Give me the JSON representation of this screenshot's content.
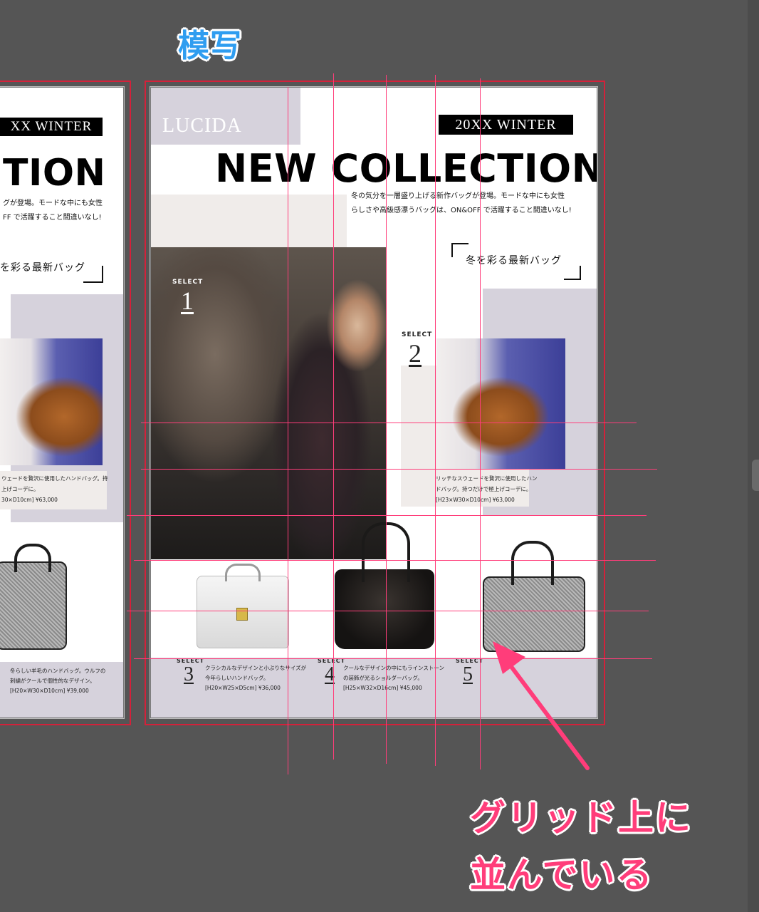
{
  "top_label": "模写",
  "annotation": {
    "line1": "グリッド上に",
    "line2": "並んでいる"
  },
  "poster": {
    "brand": "LUCIDA",
    "season": "20XX WINTER",
    "headline": "NEW COLLECTION",
    "desc_line1": "冬の気分を一層盛り上げる新作バッグが登場。モードな中にも女性",
    "desc_line2": "らしさや高級感漂うバッグは、ON&OFF で活躍すること間違いなし!",
    "bracket_text": "冬を彩る最新バッグ",
    "select_label": "SELECT",
    "items": [
      {
        "num": "1"
      },
      {
        "num": "2",
        "line1": "リッチなスウェードを贅沢に使用したハン",
        "line2": "ドバッグ。持つだけで極上げコーデに。",
        "line3": "[H23×W30×D10cm] ¥63,000"
      },
      {
        "num": "3",
        "line1": "クラシカルなデザインと小ぶりなサイズが",
        "line2": "今年らしいハンドバッグ。",
        "line3": "[H20×W25×D5cm] ¥36,000"
      },
      {
        "num": "4",
        "line1": "クールなデザインの中にもラインストーン",
        "line2": "の装飾が光るショルダーバッグ。",
        "line3": "[H25×W32×D16cm] ¥45,000"
      },
      {
        "num": "5"
      }
    ]
  },
  "original": {
    "season_cut": "XX WINTER",
    "headline_cut": "TION",
    "desc_line1": "グが登場。モードな中にも女性",
    "desc_line2": "FF で活躍すること間違いなし!",
    "bracket_text": "を彩る最新バッグ",
    "item2_line1": "ウェードを贅沢に使用したハンドバッグ。持",
    "item2_line2": "上げコーデに。",
    "item2_line3": "30×D10cm] ¥63,000",
    "item5_line1": "冬らしい羊毛のハンドバッグ。ウルフの",
    "item5_line2": "刺繍がクールで個性的なデザイン。",
    "item5_line3": "[H20×W30×D10cm] ¥39,000"
  },
  "colors": {
    "guide": "#ff3d7a",
    "frame": "#d4213a",
    "label_blue": "#2f9df0",
    "lavender": "#d6d2dc",
    "beige": "#f0ecea"
  }
}
